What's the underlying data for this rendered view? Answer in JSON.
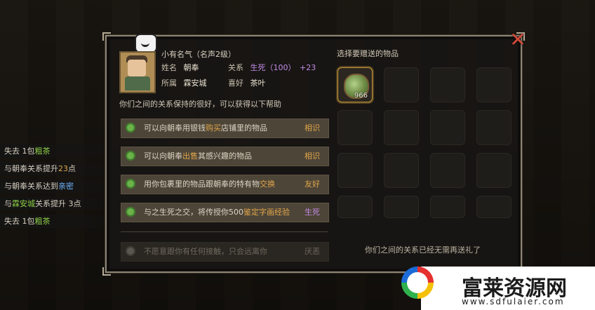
{
  "log": {
    "lines": [
      {
        "prefix": "失去 1包",
        "hl": "粗茶",
        "suffix": "",
        "hl_color": "green"
      },
      {
        "prefix": "与朝奉关系提升",
        "hl": "23",
        "suffix": "点",
        "hl_color": "orange"
      },
      {
        "prefix": "与朝奉关系达到",
        "hl": "亲密",
        "suffix": "",
        "hl_color": "blue"
      },
      {
        "prefix": "与",
        "hl": "霖安城",
        "suffix": "关系提升 3点",
        "hl_color": "green"
      },
      {
        "prefix": "失去 1包",
        "hl": "粗茶",
        "suffix": "",
        "hl_color": "green"
      }
    ]
  },
  "npc": {
    "title": "小有名气（名声2级）",
    "name_label": "姓名",
    "name": "朝奉",
    "relation_label": "关系",
    "relation_value": "生死",
    "relation_points": "（100）",
    "relation_delta": "+23",
    "origin_label": "所属",
    "origin": "霖安城",
    "likes_label": "喜好",
    "likes": "茶叶"
  },
  "desc": "你们之间的关系保持的很好，可以获得以下帮助",
  "benefits": [
    {
      "pre": "可以向朝奉用银钱",
      "hl": "购买",
      "post": "店铺里的物品",
      "tag": "相识",
      "tag_color": "orange",
      "dim": false
    },
    {
      "pre": "可以向朝奉",
      "hl": "出售",
      "post": "其感兴趣的物品",
      "tag": "相识",
      "tag_color": "orange",
      "dim": false
    },
    {
      "pre": "用你包裹里的物品跟朝奉的特有物",
      "hl": "交换",
      "post": "",
      "tag": "友好",
      "tag_color": "orange",
      "dim": false
    },
    {
      "pre": "与之生死之交，将传授你500",
      "hl": "鉴定字画经验",
      "post": "",
      "tag": "生死",
      "tag_color": "purple",
      "dim": false
    },
    {
      "pre": "不愿意跟你有任何接触，只会远离你",
      "hl": "",
      "post": "",
      "tag": "厌恶",
      "tag_color": "orange",
      "dim": true
    }
  ],
  "gift": {
    "title": "选择要赠送的物品",
    "selected_item_count": "966",
    "status": "你们之间的关系已经无需再送礼了"
  },
  "watermark": {
    "main": "富莱资源网",
    "sub": "www.sdfulaier.com"
  }
}
